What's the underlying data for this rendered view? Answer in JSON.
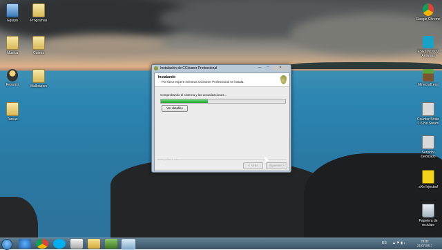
{
  "desktop": {
    "left_icons": [
      {
        "label": "Equipo",
        "icon": "computer-icon"
      },
      {
        "label": "Programas",
        "icon": "folder-icon"
      },
      {
        "label": "Musica",
        "icon": "folder-icon"
      },
      {
        "label": "Galeria",
        "icon": "folder-icon"
      },
      {
        "label": "Resumir",
        "icon": "user-icon"
      },
      {
        "label": "Wallpapers",
        "icon": "folder-icon"
      },
      {
        "label": "Tareas",
        "icon": "folder-icon"
      }
    ],
    "right_icons": [
      {
        "label": "Google Chrome",
        "icon": "chrome-icon"
      },
      {
        "label": "ESET NOD32 Antivirus",
        "icon": "eset-icon"
      },
      {
        "label": "Minecraft.exe",
        "icon": "minecraft-icon"
      },
      {
        "label": "Counter Strike 1.6 No Steam",
        "icon": "counter-strike-icon"
      },
      {
        "label": "Servidor Dedicado",
        "icon": "counter-strike-icon"
      },
      {
        "label": "sXe Injected",
        "icon": "sxe-icon"
      },
      {
        "label": "Papelera de reciclaje",
        "icon": "recycle-bin-icon"
      }
    ]
  },
  "dialog": {
    "title": "Instalación de CCleaner Professional",
    "minimize": "—",
    "maximize": "□",
    "close": "✕",
    "header_title": "Instalando",
    "header_subtitle": "Por favor espere mientras CCleaner Professional se instala.",
    "status": "Comprobando el sistema y las actualizaciones...",
    "progress_fraction": 0.38,
    "details_label": "Ver detalles",
    "brand": "www.piriform.com",
    "back_label": "< Atrás",
    "next_label": "Siguiente >"
  },
  "taskbar": {
    "items": [
      "ie-icon",
      "chrome-icon",
      "skype-icon",
      "media-icon",
      "paint-icon",
      "folder-icon",
      "game-icon",
      "notes-icon",
      "ccleaner-icon"
    ],
    "language": "ES",
    "tray": "▲ ⚑ ▮ ♪",
    "time": "23:02",
    "date": "21/07/2017"
  },
  "colors": {
    "progress": "#1f9d2a",
    "dialog_frame": "#b9c9d8"
  }
}
